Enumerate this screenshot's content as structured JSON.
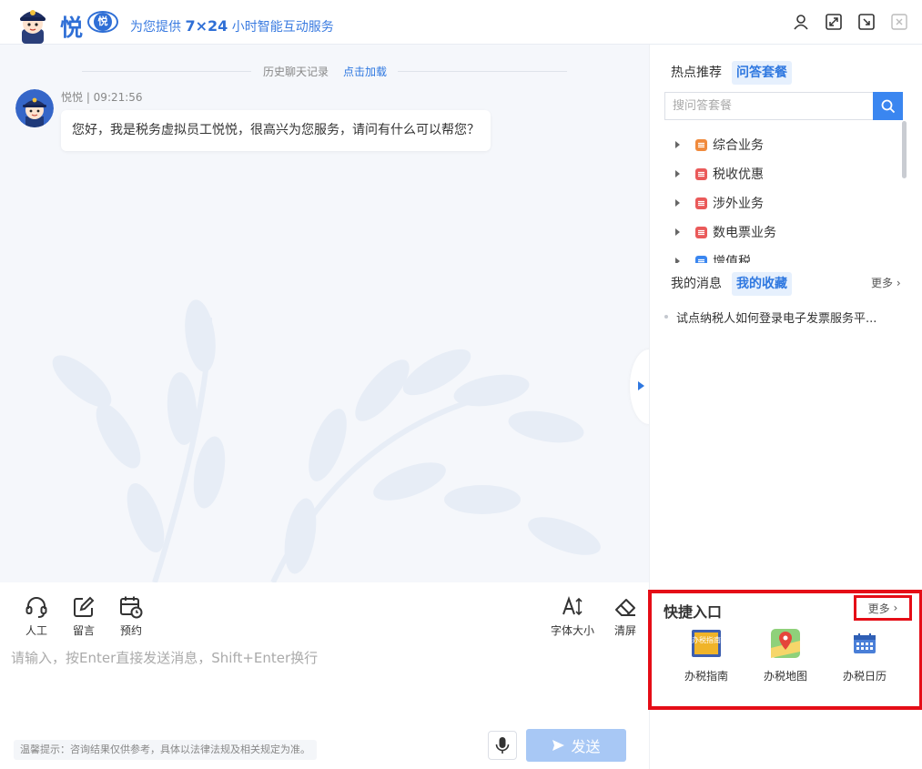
{
  "header": {
    "brand_word": "悦",
    "badge_text": "悦",
    "slogan_prefix": "为您提供",
    "slogan_bold": "7×24",
    "slogan_suffix": "小时智能互动服务",
    "icons": [
      "user-icon",
      "expand-icon",
      "minimize-icon",
      "close-icon"
    ]
  },
  "chat": {
    "history_label": "历史聊天记录",
    "history_link": "点击加载",
    "message": {
      "sender": "悦悦",
      "time": "09:21:56",
      "meta": "悦悦 | 09:21:56",
      "text": "您好，我是税务虚拟员工悦悦，很高兴为您服务，请问有什么可以帮您？"
    }
  },
  "toolbar": {
    "human_label": "人工",
    "message_label": "留言",
    "booking_label": "预约",
    "font_size_label": "字体大小",
    "clear_label": "清屏"
  },
  "input": {
    "placeholder": "请输入，按Enter直接发送消息，Shift+Enter换行",
    "tip": "温馨提示：咨询结果仅供参考，具体以法律法规及相关规定为准。",
    "send_label": "发送"
  },
  "right": {
    "tab_hot": "热点推荐",
    "tab_qa": "问答套餐",
    "search_placeholder": "搜问答套餐",
    "tree": [
      {
        "label": "综合业务",
        "color": "#f08a3c"
      },
      {
        "label": "税收优惠",
        "color": "#ea5a5a"
      },
      {
        "label": "涉外业务",
        "color": "#ea5a5a"
      },
      {
        "label": "数电票业务",
        "color": "#ea5a5a"
      },
      {
        "label": "增值税",
        "color": "#3a86f0"
      }
    ],
    "tab_msg": "我的消息",
    "tab_fav": "我的收藏",
    "more_label": "更多",
    "fav_item": "试点纳税人如何登录电子发票服务平...",
    "quick": {
      "title": "快捷入口",
      "more_label": "更多",
      "items": [
        {
          "label": "办税指南",
          "icon_text": "办税指南"
        },
        {
          "label": "办税地图"
        },
        {
          "label": "办税日历"
        }
      ]
    }
  },
  "colors": {
    "accent": "#2f78e0",
    "send_disabled": "#a8c8f5",
    "highlight_red": "#e50d17"
  }
}
